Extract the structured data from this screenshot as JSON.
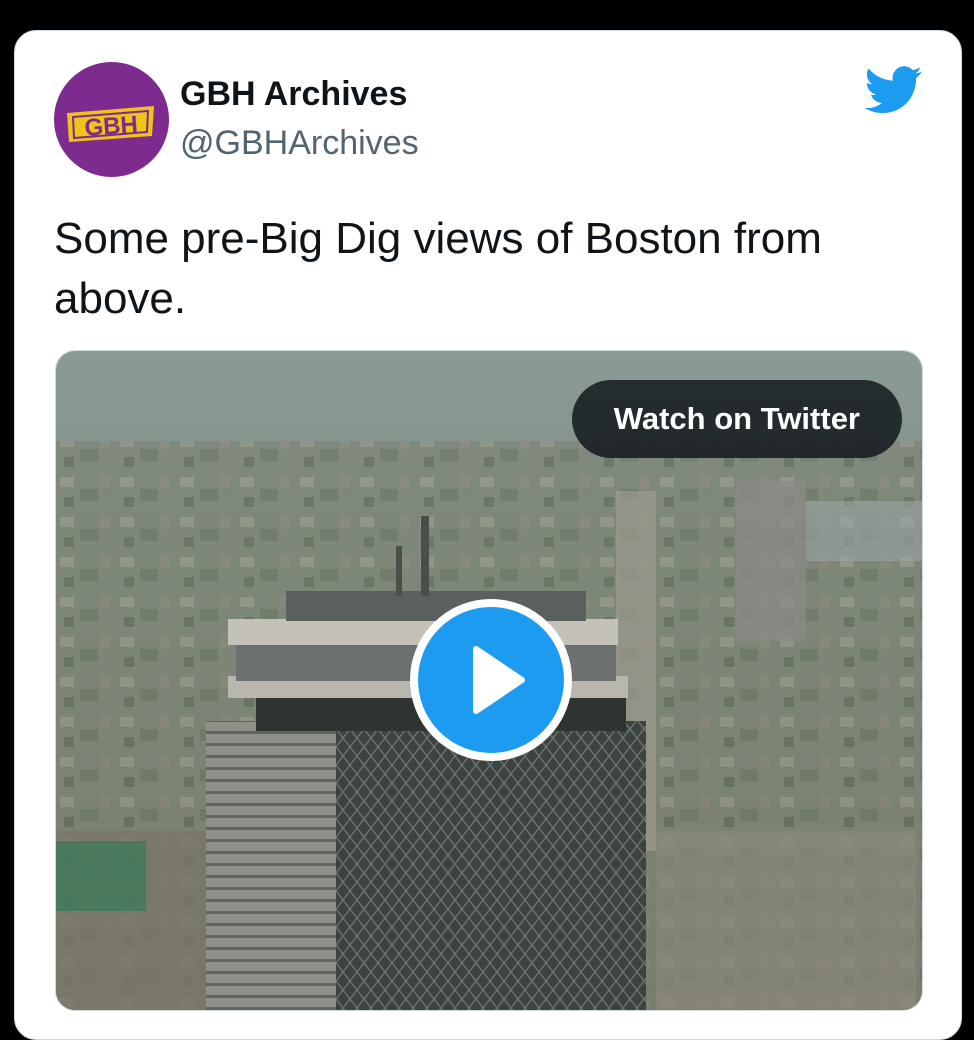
{
  "tweet": {
    "author": {
      "display_name": "GBH Archives",
      "handle": "@GBHArchives",
      "avatar_logo_text": "GBH",
      "avatar_color": "#7d2b8f",
      "avatar_logo_color": "#f2c21a"
    },
    "text": "Some pre-Big Dig views of Boston from above.",
    "media": {
      "type": "video",
      "watch_label": "Watch on Twitter",
      "play_icon": "play-icon",
      "play_color": "#1d9bf0"
    },
    "platform_icon": "twitter-bird-icon",
    "brand_color": "#1d9bf0"
  }
}
